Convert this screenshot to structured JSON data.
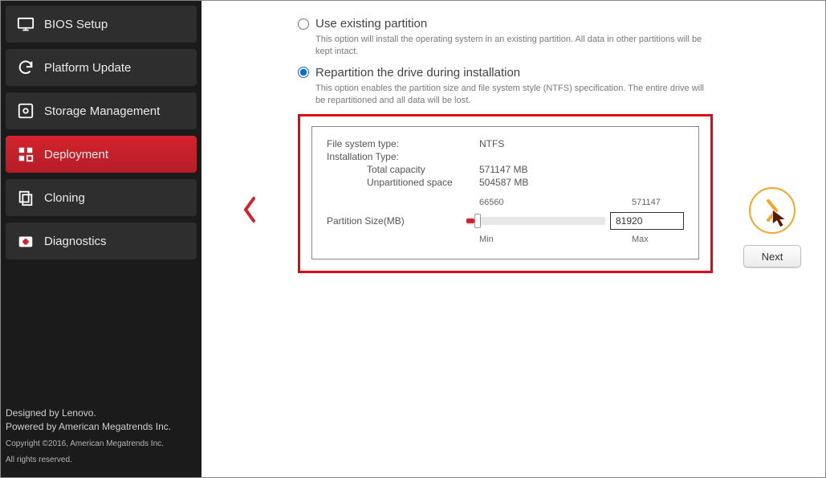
{
  "sidebar": {
    "items": [
      {
        "label": "BIOS Setup",
        "icon": "monitor-icon"
      },
      {
        "label": "Platform Update",
        "icon": "refresh-icon"
      },
      {
        "label": "Storage Management",
        "icon": "disk-icon"
      },
      {
        "label": "Deployment",
        "icon": "grid-icon"
      },
      {
        "label": "Cloning",
        "icon": "copy-icon"
      },
      {
        "label": "Diagnostics",
        "icon": "medkit-icon"
      }
    ],
    "active_index": 3
  },
  "footer": {
    "line1": "Designed by Lenovo.",
    "line2": "Powered by American Megatrends Inc.",
    "copyright1": "Copyright ©2016, American Megatrends Inc.",
    "copyright2": "All rights reserved."
  },
  "partitionMode": {
    "option1": {
      "label": "Use existing partition",
      "desc": "This option will install the operating system in an existing partition. All data in other partitions will be kept intact."
    },
    "option2": {
      "label": "Repartition the drive during installation",
      "desc": "This option enables the partition size and file system style (NTFS) specification. The entire drive will be repartitioned and all data will be lost."
    },
    "selected": "option2"
  },
  "partition": {
    "fsTypeLabel": "File system type:",
    "fsTypeValue": "NTFS",
    "instTypeLabel": "Installation Type:",
    "totalLabel": "Total capacity",
    "totalValue": "571147 MB",
    "unpartLabel": "Unpartitioned space",
    "unpartValue": "504587 MB",
    "sliderMinValue": "66560",
    "sliderMaxValue": "571147",
    "sizeLabel": "Partition Size(MB)",
    "sizeValue": "81920",
    "minLabel": "Min",
    "maxLabel": "Max"
  },
  "nav": {
    "nextLabel": "Next"
  }
}
